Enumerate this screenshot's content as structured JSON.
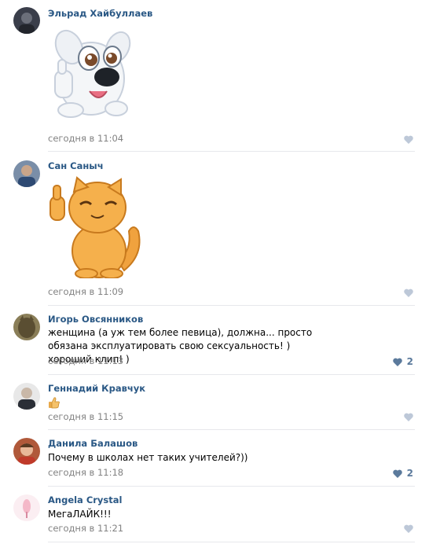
{
  "comments": [
    {
      "author": "Эльрад Хайбуллаев",
      "text": "",
      "date": "сегодня в 11:04",
      "likes": "",
      "sticker": "dog-sticker"
    },
    {
      "author": "Сан Саныч",
      "text": "",
      "date": "сегодня в 11:09",
      "likes": "",
      "sticker": "cat-sticker"
    },
    {
      "author": "Игорь Овсянников",
      "text": "женщина (а уж тем более певица), должна... просто обязана эксплуатировать свою сексуальность! ) хороший клип! )",
      "date": "сегодня в 11:13",
      "likes": "2"
    },
    {
      "author": "Геннадий Кравчук",
      "text": "",
      "date": "сегодня в 11:15",
      "likes": "",
      "emoji": "thumbs-up-emoji"
    },
    {
      "author": "Данила Балашов",
      "text": "Почему в школах нет таких учителей?))",
      "date": "сегодня в 11:18",
      "likes": "2"
    },
    {
      "author": "Angela Crystal",
      "text": "МегаЛАЙК!!!",
      "date": "сегодня в 11:21",
      "likes": ""
    }
  ],
  "colors": {
    "author": "#2a5885",
    "date": "#828282",
    "like_icon": "#bdc8d8",
    "like_count": "#5b7a9c",
    "divider": "#e7e8ec"
  }
}
